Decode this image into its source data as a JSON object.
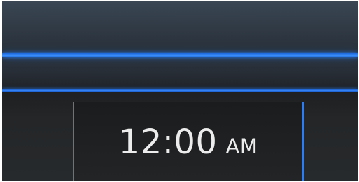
{
  "clock": {
    "time": "12:00",
    "meridiem": "AM"
  },
  "colors": {
    "accent": "#1e7cff",
    "top_panel": "#313b46",
    "bottom_panel": "#242628",
    "clock_text": "#ececec"
  }
}
